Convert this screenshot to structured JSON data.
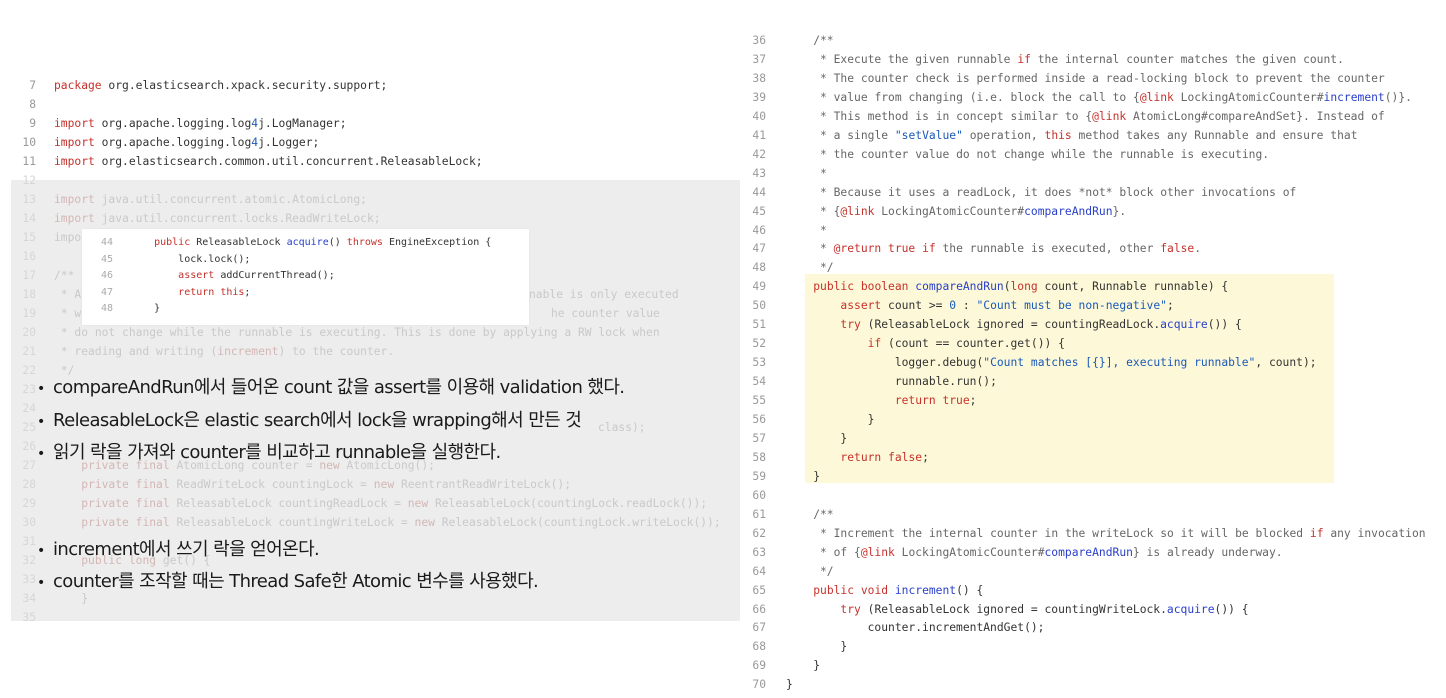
{
  "left_code": {
    "visible_lines": [
      {
        "n": "7",
        "text": "package org.elasticsearch.xpack.security.support;"
      },
      {
        "n": "8",
        "text": ""
      },
      {
        "n": "9",
        "text": "import org.apache.logging.log4j.LogManager;"
      },
      {
        "n": "10",
        "text": "import org.apache.logging.log4j.Logger;"
      },
      {
        "n": "11",
        "text": "import org.elasticsearch.common.util.concurrent.ReleasableLock;"
      }
    ],
    "faded_lines": [
      {
        "n": "12",
        "text": ""
      },
      {
        "n": "13",
        "text": "import java.util.concurrent.atomic.AtomicLong;"
      },
      {
        "n": "14",
        "text": "import java.util.concurrent.locks.ReadWriteLock;"
      },
      {
        "n": "15",
        "text": "impo"
      },
      {
        "n": "16",
        "text": ""
      },
      {
        "n": "17",
        "text": "/**"
      },
      {
        "n": "18",
        "text": " * A",
        "tail": "nable is only executed"
      },
      {
        "n": "19",
        "text": " * w",
        "tail": "he counter value"
      },
      {
        "n": "20",
        "text": " * do not change while the runnable is executing. This is done by applying a RW lock when"
      },
      {
        "n": "21",
        "text": " * reading and writing (increment) to the counter."
      },
      {
        "n": "22",
        "text": " */"
      },
      {
        "n": "23",
        "text": ""
      },
      {
        "n": "24",
        "text": ""
      },
      {
        "n": "25",
        "text": "",
        "tail": "class);"
      },
      {
        "n": "26",
        "text": ""
      },
      {
        "n": "27",
        "text": "    private final AtomicLong counter = new AtomicLong();"
      },
      {
        "n": "28",
        "text": "    private final ReadWriteLock countingLock = new ReentrantReadWriteLock();"
      },
      {
        "n": "29",
        "text": "    private final ReleasableLock countingReadLock = new ReleasableLock(countingLock.readLock());"
      },
      {
        "n": "30",
        "text": "    private final ReleasableLock countingWriteLock = new ReleasableLock(countingLock.writeLock());"
      },
      {
        "n": "31",
        "text": ""
      },
      {
        "n": "32",
        "text": "    public long get() {"
      },
      {
        "n": "33",
        "text": ""
      },
      {
        "n": "34",
        "text": "    }"
      },
      {
        "n": "35",
        "text": ""
      }
    ],
    "snippet": [
      {
        "n": "44",
        "text": "    public ReleasableLock acquire() throws EngineException {"
      },
      {
        "n": "45",
        "text": "        lock.lock();"
      },
      {
        "n": "46",
        "text": "        assert addCurrentThread();"
      },
      {
        "n": "47",
        "text": "        return this;"
      },
      {
        "n": "48",
        "text": "    }"
      }
    ]
  },
  "bullets_top": [
    "compareAndRun에서 들어온 count 값을 assert를 이용해 validation 했다.",
    "ReleasableLock은 elastic search에서 lock을 wrapping해서 만든 것",
    "읽기 락을 가져와 counter를 비교하고 runnable을 실행한다."
  ],
  "bullets_bottom": [
    "increment에서 쓰기 락을 얻어온다.",
    "counter를 조작할 때는 Thread Safe한 Atomic 변수를 사용했다."
  ],
  "bullet_glyph": "•",
  "right_code": [
    {
      "n": "36",
      "text": "    /**"
    },
    {
      "n": "37",
      "text": "     * Execute the given runnable if the internal counter matches the given count."
    },
    {
      "n": "38",
      "text": "     * The counter check is performed inside a read-locking block to prevent the counter"
    },
    {
      "n": "39",
      "text": "     * value from changing (i.e. block the call to {@link LockingAtomicCounter#increment()}."
    },
    {
      "n": "40",
      "text": "     * This method is in concept similar to {@link AtomicLong#compareAndSet}. Instead of"
    },
    {
      "n": "41",
      "text": "     * a single \"setValue\" operation, this method takes any Runnable and ensure that"
    },
    {
      "n": "42",
      "text": "     * the counter value do not change while the runnable is executing."
    },
    {
      "n": "43",
      "text": "     *"
    },
    {
      "n": "44",
      "text": "     * Because it uses a readLock, it does *not* block other invocations of"
    },
    {
      "n": "45",
      "text": "     * {@link LockingAtomicCounter#compareAndRun}."
    },
    {
      "n": "46",
      "text": "     *"
    },
    {
      "n": "47",
      "text": "     * @return true if the runnable is executed, other false."
    },
    {
      "n": "48",
      "text": "     */"
    },
    {
      "n": "49",
      "text": "    public boolean compareAndRun(long count, Runnable runnable) {"
    },
    {
      "n": "50",
      "text": "        assert count >= 0 : \"Count must be non-negative\";"
    },
    {
      "n": "51",
      "text": "        try (ReleasableLock ignored = countingReadLock.acquire()) {"
    },
    {
      "n": "52",
      "text": "            if (count == counter.get()) {"
    },
    {
      "n": "53",
      "text": "                logger.debug(\"Count matches [{}], executing runnable\", count);"
    },
    {
      "n": "54",
      "text": "                runnable.run();"
    },
    {
      "n": "55",
      "text": "                return true;"
    },
    {
      "n": "56",
      "text": "            }"
    },
    {
      "n": "57",
      "text": "        }"
    },
    {
      "n": "58",
      "text": "        return false;"
    },
    {
      "n": "59",
      "text": "    }"
    },
    {
      "n": "60",
      "text": ""
    },
    {
      "n": "61",
      "text": "    /**"
    },
    {
      "n": "62",
      "text": "     * Increment the internal counter in the writeLock so it will be blocked if any invocation"
    },
    {
      "n": "63",
      "text": "     * of {@link LockingAtomicCounter#compareAndRun} is already underway."
    },
    {
      "n": "64",
      "text": "     */"
    },
    {
      "n": "65",
      "text": "    public void increment() {"
    },
    {
      "n": "66",
      "text": "        try (ReleasableLock ignored = countingWriteLock.acquire()) {"
    },
    {
      "n": "67",
      "text": "            counter.incrementAndGet();"
    },
    {
      "n": "68",
      "text": "        }"
    },
    {
      "n": "69",
      "text": "    }"
    },
    {
      "n": "70",
      "text": "}"
    }
  ]
}
